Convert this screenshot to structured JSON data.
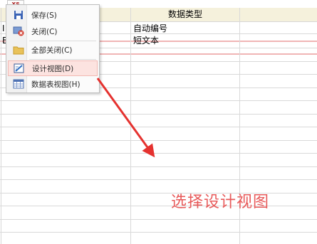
{
  "tab": {
    "label": "xs"
  },
  "grid": {
    "header_type": "数据类型",
    "rows": [
      {
        "name_partial": "I",
        "type": "自动编号"
      },
      {
        "name_partial": "B",
        "type": "短文本"
      }
    ]
  },
  "context_menu": {
    "items": [
      {
        "label": "保存(S)",
        "icon": "save-icon"
      },
      {
        "label": "关闭(C)",
        "icon": "close-icon"
      },
      {
        "label": "全部关闭(C)",
        "icon": "folder-icon"
      },
      {
        "label": "设计视图(D)",
        "icon": "design-view-icon",
        "active": true
      },
      {
        "label": "数据表视图(H)",
        "icon": "datasheet-view-icon"
      }
    ]
  },
  "annotation": {
    "text": "选择设计视图",
    "color": "#e85a5a"
  },
  "colors": {
    "header_bg": "#f5f1dc",
    "pink_line": "#f0b5b5",
    "highlight": "#fce3e0"
  }
}
